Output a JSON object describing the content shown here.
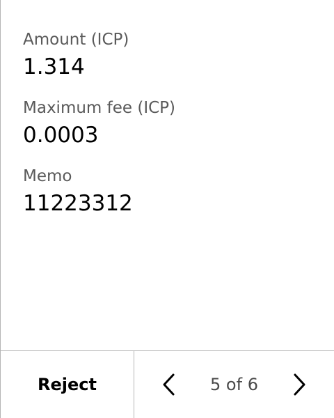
{
  "fields": [
    {
      "label": "Amount (ICP)",
      "value": "1.314"
    },
    {
      "label": "Maximum fee (ICP)",
      "value": "0.0003"
    },
    {
      "label": "Memo",
      "value": "11223312"
    }
  ],
  "footer": {
    "reject_label": "Reject",
    "page_indicator": "5 of 6"
  },
  "icons": {
    "prev": "chevron-left-icon",
    "next": "chevron-right-icon"
  }
}
